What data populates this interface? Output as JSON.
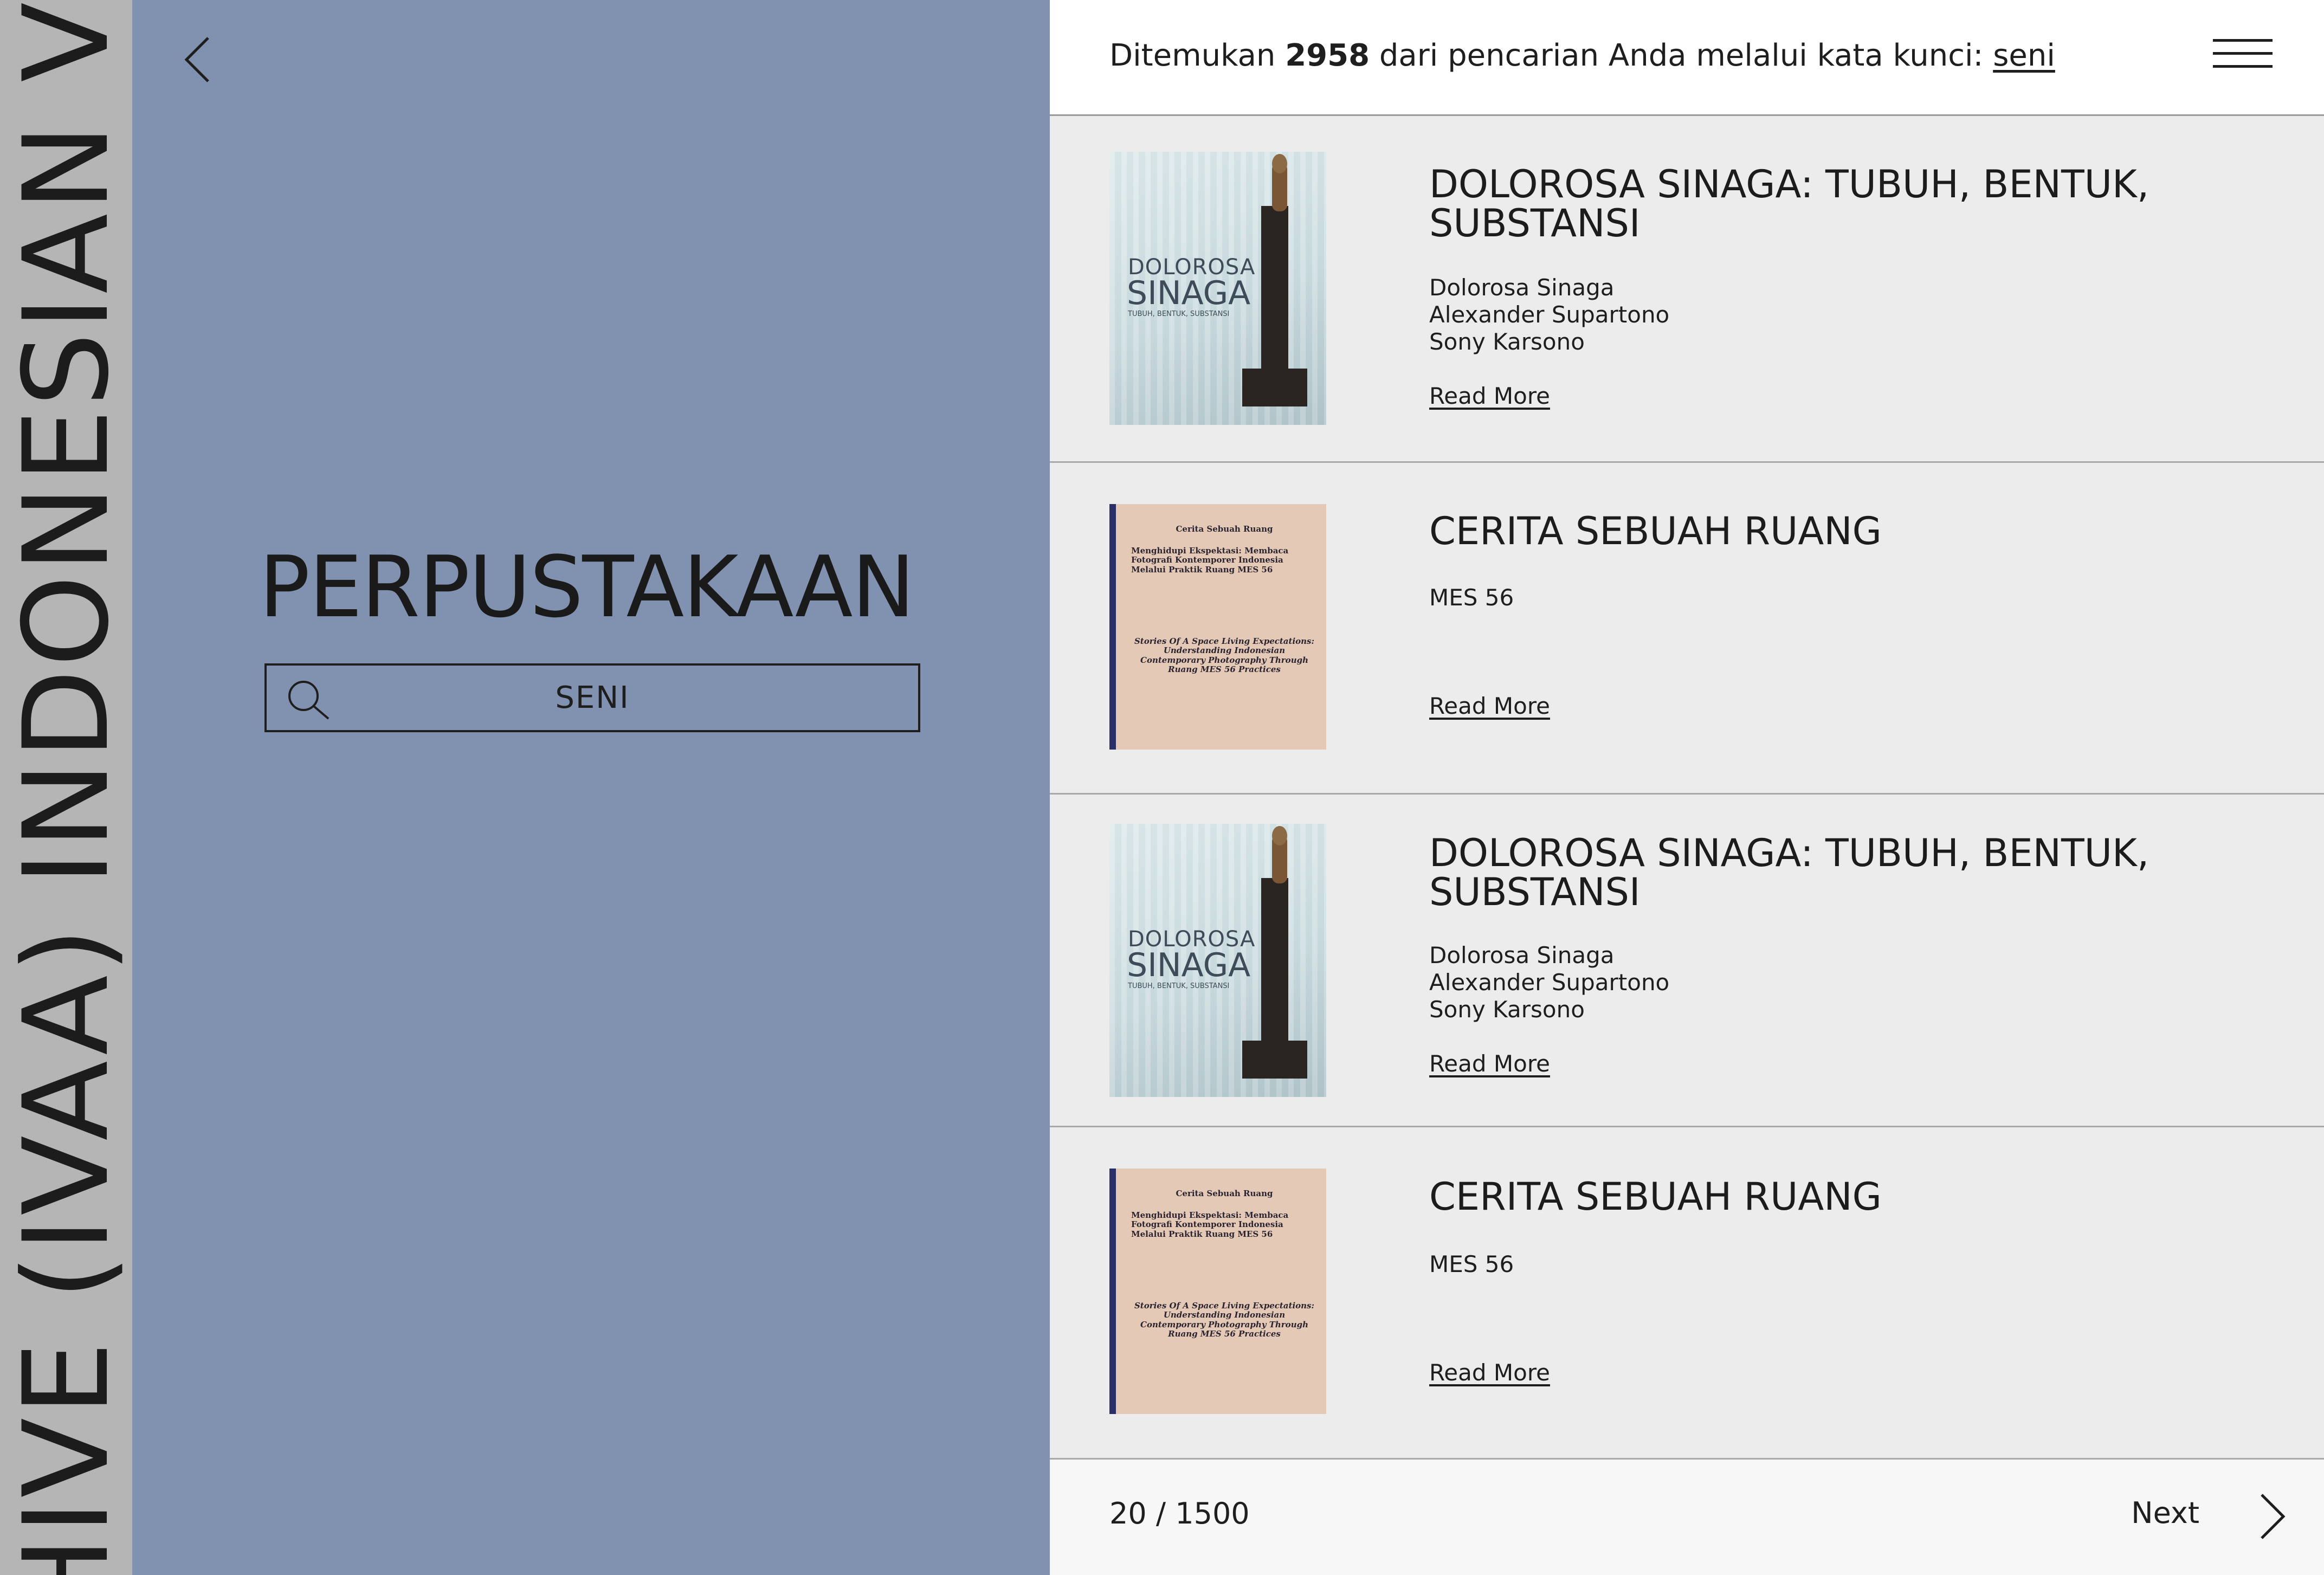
{
  "side_band": {
    "text": "INDONESIAN VISUAL ART ARCHIVE (IVAA) INDONESIAN V"
  },
  "search_panel": {
    "title": "PERPUSTAKAAN",
    "search_value": "SENI",
    "background_color": "#8092b0"
  },
  "results_header": {
    "prefix": "Ditemukan",
    "count": "2958",
    "middle": "dari pencarian Anda melalui kata kunci:",
    "keyword": "seni"
  },
  "results": [
    {
      "title": "DOLOROSA SINAGA: TUBUH, BENTUK, SUBSTANSI",
      "authors": [
        "Dolorosa Sinaga",
        "Alexander Supartono",
        "Sony Karsono"
      ],
      "read_more": "Read More",
      "cover": {
        "title_line1": "DOLOROSA",
        "title_line2": "SINAGA",
        "subtitle": "TUBUH, BENTUK, SUBSTANSI"
      }
    },
    {
      "title": "CERITA SEBUAH RUANG",
      "authors": [
        "MES 56"
      ],
      "read_more": "Read More",
      "cover": {
        "heading": "Cerita Sebuah Ruang",
        "line_a": "Menghidupi Ekspektasi: Membaca Fotografi Kontemporer Indonesia Melalui Praktik Ruang MES 56",
        "line_b": "Stories Of A Space Living Expectations: Understanding Indonesian Contemporary Photography Through Ruang MES 56 Practices"
      }
    },
    {
      "title": "DOLOROSA SINAGA: TUBUH, BENTUK, SUBSTANSI",
      "authors": [
        "Dolorosa Sinaga",
        "Alexander Supartono",
        "Sony Karsono"
      ],
      "read_more": "Read More",
      "cover": {
        "title_line1": "DOLOROSA",
        "title_line2": "SINAGA",
        "subtitle": "TUBUH, BENTUK, SUBSTANSI"
      }
    },
    {
      "title": "CERITA SEBUAH RUANG",
      "authors": [
        "MES 56"
      ],
      "read_more": "Read More",
      "cover": {
        "heading": "Cerita Sebuah Ruang",
        "line_a": "Menghidupi Ekspektasi: Membaca Fotografi Kontemporer Indonesia Melalui Praktik Ruang MES 56",
        "line_b": "Stories Of A Space Living Expectations: Understanding Indonesian Contemporary Photography Through Ruang MES 56 Practices"
      }
    }
  ],
  "footer": {
    "pagination": "20 / 1500",
    "next_label": "Next"
  },
  "icons": {
    "back": "chevron-left-icon",
    "search": "search-icon",
    "menu": "hamburger-menu-icon",
    "next": "chevron-right-icon"
  }
}
